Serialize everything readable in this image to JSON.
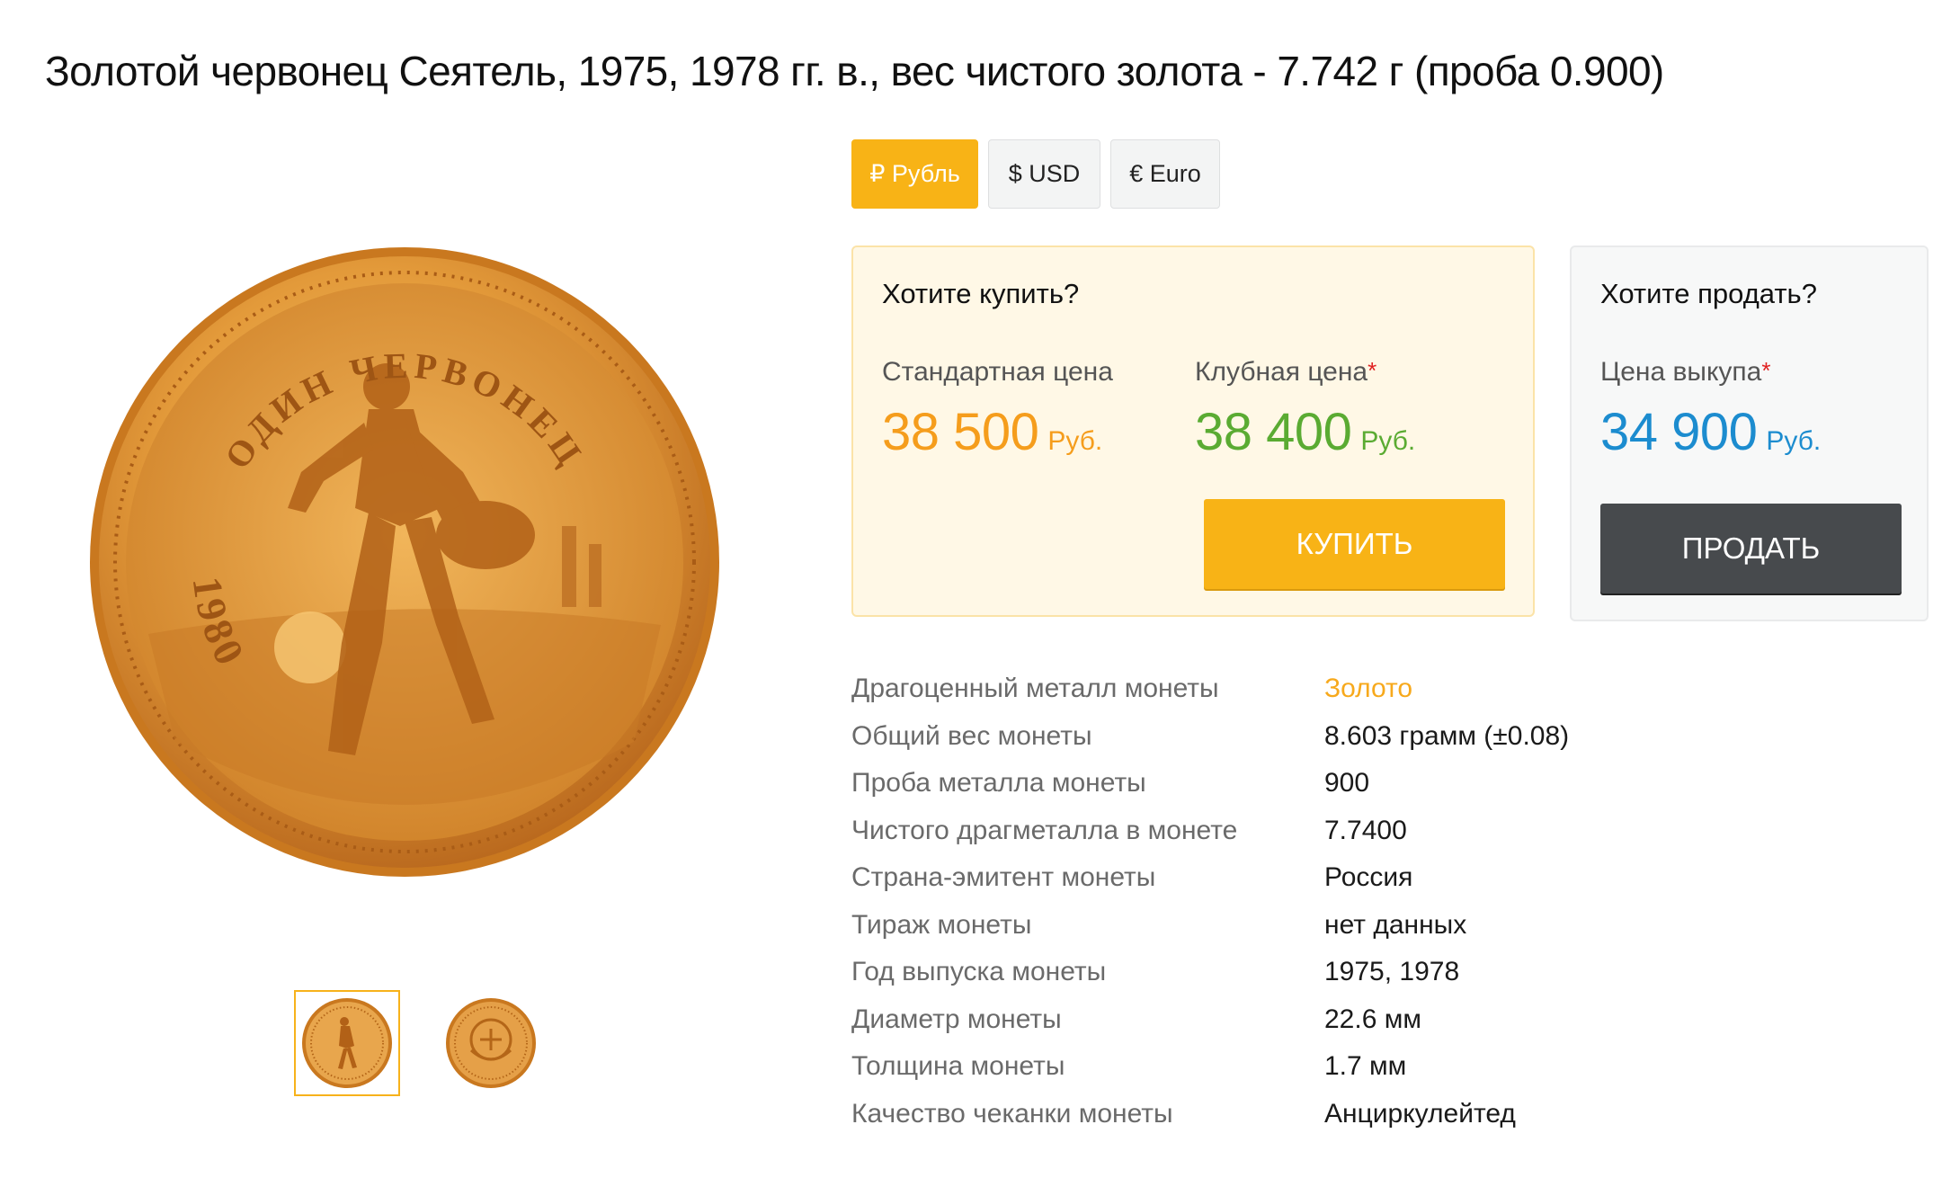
{
  "title": "Золотой червонец Сеятель, 1975, 1978 гг. в., вес чистого золота - 7.742 г (проба 0.900)",
  "currency": {
    "selected": "rub",
    "options": [
      {
        "id": "rub",
        "label": "₽ Рубль"
      },
      {
        "id": "usd",
        "label": "$ USD"
      },
      {
        "id": "eur",
        "label": "€ Euro"
      }
    ]
  },
  "buy": {
    "heading": "Хотите купить?",
    "standard_label": "Стандартная цена",
    "standard_price": "38 500",
    "club_label": "Клубная цена",
    "club_price": "38 400",
    "unit": "Руб.",
    "button": "КУПИТЬ"
  },
  "sell": {
    "heading": "Хотите продать?",
    "buyback_label": "Цена выкупа",
    "buyback_price": "34 900",
    "unit": "Руб.",
    "button": "ПРОДАТЬ"
  },
  "required_mark": "*",
  "coin": {
    "inscription": "ОДИН ЧЕРВОНЕЦ",
    "year": "1980"
  },
  "specs": [
    {
      "label": "Драгоценный металл монеты",
      "value": "Золото"
    },
    {
      "label": "Общий вес монеты",
      "value": "8.603 грамм (±0.08)"
    },
    {
      "label": "Проба металла монеты",
      "value": "900"
    },
    {
      "label": "Чистого драгметалла в монете",
      "value": "7.7400"
    },
    {
      "label": "Страна-эмитент монеты",
      "value": "Россия"
    },
    {
      "label": "Тираж монеты",
      "value": "нет данных"
    },
    {
      "label": "Год выпуска монеты",
      "value": "1975, 1978"
    },
    {
      "label": "Диаметр монеты",
      "value": "22.6 мм"
    },
    {
      "label": "Толщина монеты",
      "value": "1.7 мм"
    },
    {
      "label": "Качество чеканки монеты",
      "value": "Анциркулейтед"
    }
  ],
  "colors": {
    "accent_orange": "#f8b316",
    "price_orange": "#f59d1c",
    "price_green": "#5aab32",
    "price_blue": "#1c8ccf",
    "sell_button": "#474a4d"
  }
}
